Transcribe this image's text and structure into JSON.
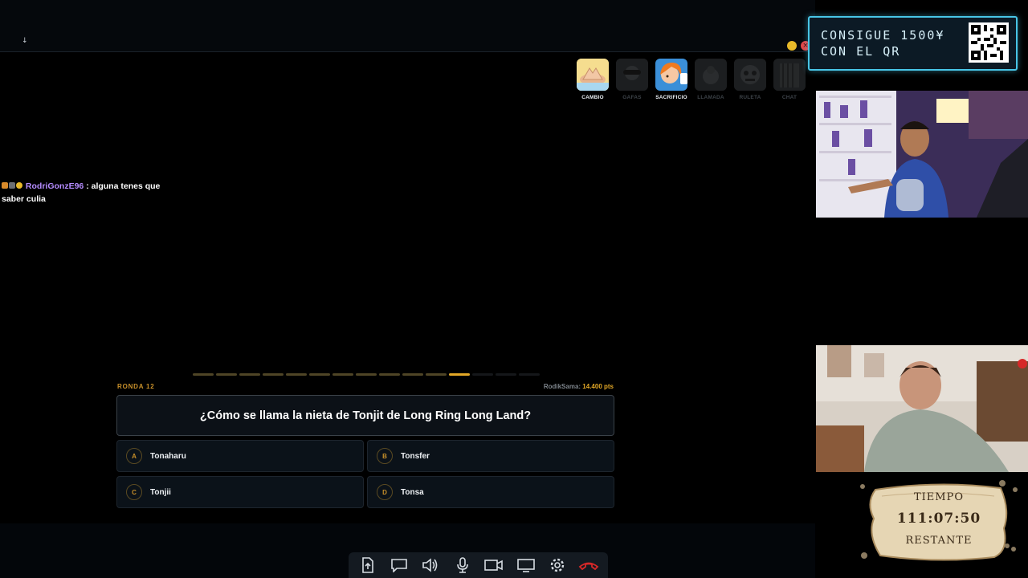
{
  "top": {
    "cursor_glyph": "↓"
  },
  "window_controls": {
    "close_glyph": "×"
  },
  "abilities": [
    {
      "label": "CAMBIO",
      "active": true
    },
    {
      "label": "GAFAS",
      "active": false
    },
    {
      "label": "SACRIFICIO",
      "active": true
    },
    {
      "label": "LLAMADA",
      "active": false
    },
    {
      "label": "RULETA",
      "active": false
    },
    {
      "label": "CHAT",
      "active": false
    }
  ],
  "chat": {
    "username": "RodriGonzE96",
    "message": ": alguna tenes que saber culia"
  },
  "quiz": {
    "round_label": "RONDA 12",
    "score_user": "RodikSama:",
    "score_value": "14.400 pts",
    "question": "¿Cómo se llama la nieta de Tonjit de Long Ring Long Land?",
    "answers": [
      {
        "letter": "A",
        "text": "Tonaharu"
      },
      {
        "letter": "B",
        "text": "Tonsfer"
      },
      {
        "letter": "C",
        "text": "Tonjii"
      },
      {
        "letter": "D",
        "text": "Tonsa"
      }
    ],
    "progress": {
      "total_rounds": 15,
      "current_round": 12
    }
  },
  "toolbar": [
    "share-screen-icon",
    "chat-icon",
    "speaker-icon",
    "microphone-icon",
    "camera-icon",
    "screen-icon",
    "settings-icon",
    "hang-up-icon"
  ],
  "promo": {
    "line1": "CONSIGUE 1500¥",
    "line2": "CON EL QR"
  },
  "timer": {
    "top": "TIEMPO",
    "value": "111:07:50",
    "bottom": "RESTANTE"
  },
  "colors": {
    "accent": "#e3a827",
    "promo_border": "#48c5e6",
    "chat_user": "#b58cff",
    "hangup": "#d62828"
  }
}
